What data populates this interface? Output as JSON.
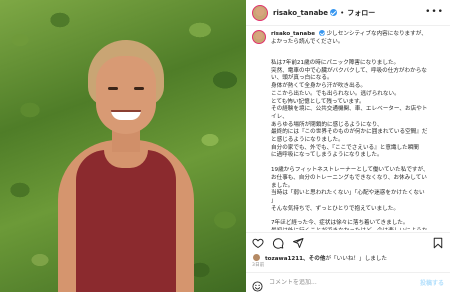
{
  "header": {
    "username": "risako_tanabe",
    "separator": "•",
    "follow_label": "フォロー",
    "more_icon": "more-dots-icon"
  },
  "caption": {
    "username": "risako_tanabe",
    "first_line": "少しセンシティブな内容になりますが、",
    "second_line": "よかったら読んでください。",
    "lines": [
      "",
      "私は7年前21歳の時にパニック障害になりました。",
      "突然、電車の中で心臓がバクバクして、呼吸の仕方がわからな",
      "い、頭が真っ白になる。",
      "身体が熱くて全身から汗が吹き出る。",
      "ここから出たい。でも出られない。逃げられない。",
      "とても怖い記憶として残っています。",
      "その経験を境に、公共交通機関、車、エレベーター、お店やト",
      "イレ、",
      "あらゆる場所が閉鎖的に感じるようになり、",
      "最終的には『この世界そのものが何かに囲まれている空間』だ",
      "と感じるようになりました。",
      "自分の家でも、外でも、『ここでさえいる』と意識した瞬間",
      "に過呼吸になってしまうようになりました。",
      "",
      "19歳からフィットネストレーナーとして働いていた私ですが、",
      "お仕事も、自分のトレーニングもできなくなり、お休みしてい",
      "ました。",
      "当時は「弱いと思われたくない」「心配や迷惑をかけたくない",
      "」",
      "そんな気持ちで、ずっとひとりで抱えていました。",
      "",
      "7年ほど経った今、症状は徐々に落ち着いてきました。",
      "最初は外に行くことができなかったけど、今は楽しいにような",
      "気持ちになって、"
    ]
  },
  "actions": {
    "like_icon": "heart-icon",
    "comment_icon": "comment-icon",
    "share_icon": "share-icon",
    "save_icon": "bookmark-icon"
  },
  "likes": {
    "liker": "tozawa1211、",
    "rest": "その他",
    "suffix": "が「いいね！」しました"
  },
  "time_ago": "3日前",
  "comment": {
    "smiley_icon": "smiley-icon",
    "placeholder": "コメントを追加...",
    "post_label": "投稿する"
  }
}
